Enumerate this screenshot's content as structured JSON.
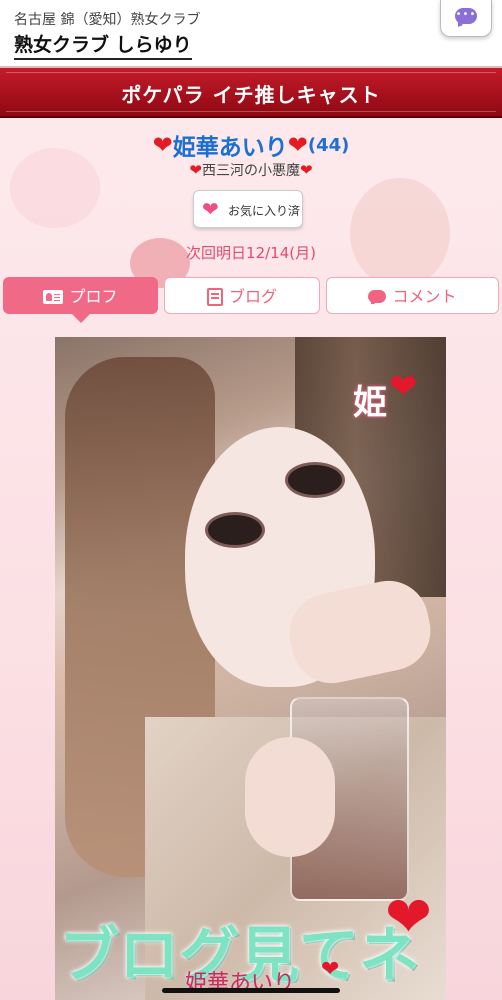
{
  "header": {
    "subtitle": "名古屋 錦（愛知）熟女クラブ",
    "shop_name": "熟女クラブ しらゆり",
    "chat_icon": "chat-bubble-icon"
  },
  "banner": {
    "title": "ポケパラ イチ推しキャスト"
  },
  "cast": {
    "heart_left": "❤",
    "name": "姫華あいり",
    "heart_right": "❤",
    "age": "(44)",
    "catch_heart_left": "❤",
    "catch": "西三河の小悪魔",
    "catch_heart_right": "❤"
  },
  "favorite": {
    "icon": "❤",
    "label": "お気に入り済"
  },
  "next_work": "次回明日12/14(月)",
  "tabs": [
    {
      "label": "プロフ",
      "icon": "profile-card-icon",
      "active": true
    },
    {
      "label": "ブログ",
      "icon": "blog-edit-icon",
      "active": false
    },
    {
      "label": "コメント",
      "icon": "comment-icon",
      "active": false
    }
  ],
  "photo": {
    "sticker_top": "姫",
    "sticker_top_heart": "❤",
    "overlay_text": "ブログ見てネ",
    "overlay_heart": "❤",
    "signature": "姫華あいり",
    "signature_heart": "❤"
  },
  "colors": {
    "banner_red": "#b01420",
    "name_blue": "#1d6fd1",
    "tab_pink": "#f06a87",
    "heart_red": "#e31b23"
  }
}
